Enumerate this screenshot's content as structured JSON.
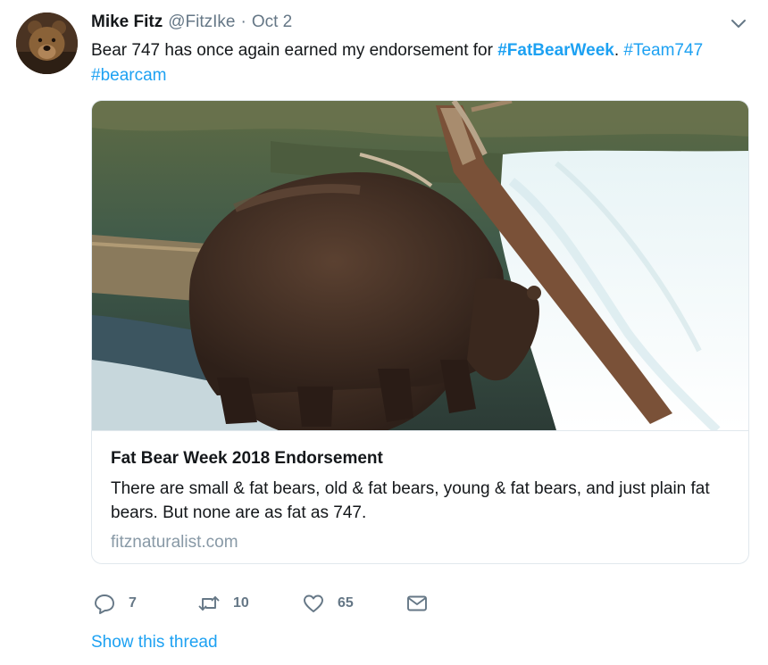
{
  "tweet": {
    "author_name": "Mike Fitz",
    "author_handle": "@FitzIke",
    "separator": "·",
    "date": "Oct 2",
    "text_before": "Bear 747 has once again earned my endorsement for ",
    "hashtag_1": "#FatBearWeek",
    "text_middle": ". ",
    "hashtag_2": "#Team747",
    "hashtag_3": "#bearcam"
  },
  "card": {
    "title": "Fat Bear Week 2018 Endorsement",
    "description": "There are small & fat bears, old & fat bears, young & fat bears, and just plain fat bears. But none are as fat as 747.",
    "domain": "fitznaturalist.com"
  },
  "actions": {
    "reply_count": "7",
    "retweet_count": "10",
    "like_count": "65"
  },
  "thread_link": "Show this thread",
  "colors": {
    "link": "#1da1f2",
    "secondary_text": "#657786",
    "border": "#e1e8ed",
    "domain_text": "#8899a6"
  },
  "icons": {
    "reply": "speech-bubble-icon",
    "retweet": "retweet-arrows-icon",
    "like": "heart-icon",
    "dm": "envelope-icon",
    "menu": "chevron-down-icon"
  }
}
